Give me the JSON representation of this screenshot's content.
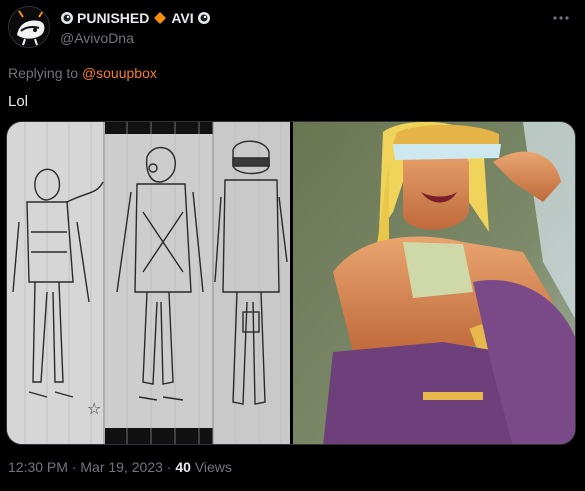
{
  "author": {
    "display_name_part1": "PUNISHED",
    "display_name_part2": "AVI",
    "handle": "@AvivoDna",
    "avatar": "avatar-icon",
    "badges": [
      "eye-icon",
      "orange-diamond-icon",
      "eye-icon"
    ]
  },
  "reply": {
    "prefix": "Replying to",
    "mention": "@souupbox"
  },
  "tweet": {
    "text": "Lol"
  },
  "media": {
    "left_image": "pencil-sketch-image",
    "right_image": "painted-illustration-image"
  },
  "meta": {
    "time": "12:30 PM",
    "separator": "·",
    "date": "Mar 19, 2023",
    "views_count": "40",
    "views_label": "Views"
  },
  "colors": {
    "background": "#000000",
    "primary_text": "#e7e9ea",
    "secondary_text": "#71767b",
    "mention": "#f47d2b",
    "border": "#2f3336",
    "badge_orange": "#f4900c"
  }
}
